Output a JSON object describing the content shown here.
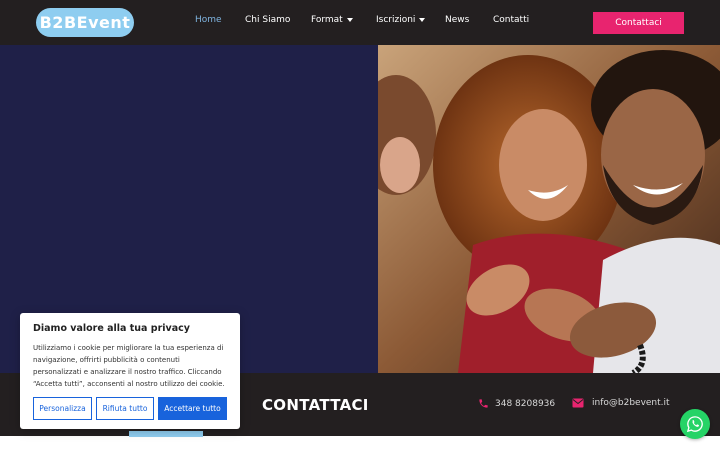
{
  "brand": {
    "logo_text": "B2BEvent"
  },
  "nav": {
    "items": [
      {
        "label": "Home",
        "active": true
      },
      {
        "label": "Chi Siamo"
      },
      {
        "label": "Format",
        "dropdown": true
      },
      {
        "label": "Iscrizioni",
        "dropdown": true
      },
      {
        "label": "News"
      },
      {
        "label": "Contatti"
      }
    ],
    "cta_label": "Contattaci"
  },
  "contact": {
    "title": "CONTATTACI",
    "phone": "348 8208936",
    "email": "info@b2bevent.it"
  },
  "cookie_banner": {
    "title": "Diamo valore alla tua privacy",
    "body": "Utilizziamo i cookie per migliorare la tua esperienza di navigazione, offrirti pubblicità o contenuti personalizzati e analizzare il nostro traffico. Cliccando “Accetta tutti”, acconsenti al nostro utilizzo dei cookie.",
    "customize_label": "Personalizza",
    "reject_label": "Rifiuta tutto",
    "accept_label": "Accettare tutto"
  },
  "colors": {
    "topbar": "#231f20",
    "accent_pink": "#e8246f",
    "hero_navy": "#1f2048",
    "logo_blue": "#8ecdf0",
    "cookie_blue": "#1863dc",
    "whatsapp_green": "#25d366"
  },
  "icons": {
    "phone": "phone-icon",
    "email": "envelope-icon",
    "whatsapp": "whatsapp-icon"
  }
}
